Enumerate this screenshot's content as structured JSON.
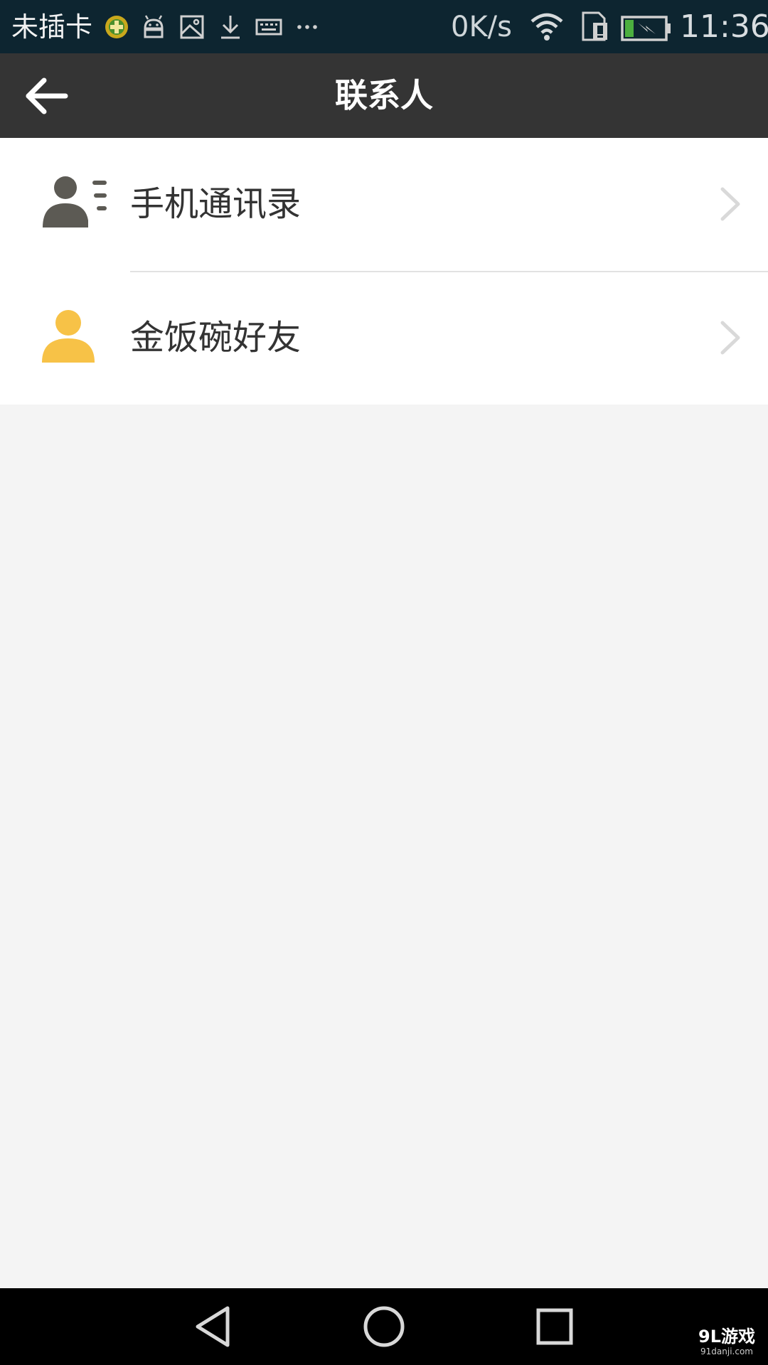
{
  "status_bar": {
    "carrier": "未插卡",
    "network_speed": "0K/s",
    "time": "11:36",
    "icons": [
      "app-plus-icon",
      "android-icon",
      "image-icon",
      "download-icon",
      "keyboard-icon",
      "more-dots-icon",
      "wifi-icon",
      "sim-icon",
      "battery-charging-icon"
    ]
  },
  "header": {
    "title": "联系人",
    "back_icon": "arrow-left-icon"
  },
  "contacts_menu": {
    "items": [
      {
        "label": "手机通讯录",
        "icon": "contact-list-icon"
      },
      {
        "label": "金饭碗好友",
        "icon": "person-icon"
      }
    ]
  },
  "nav_bar": {
    "buttons": [
      "back-triangle-icon",
      "home-circle-icon",
      "recents-square-icon"
    ]
  },
  "watermark": {
    "text": "9L游戏",
    "url": "91danji.com"
  },
  "colors": {
    "status_bar_bg": "#0d2530",
    "header_bg": "#343434",
    "page_bg": "#f4f4f4",
    "accent_yellow": "#f7c247",
    "icon_gray": "#5c5a54"
  }
}
